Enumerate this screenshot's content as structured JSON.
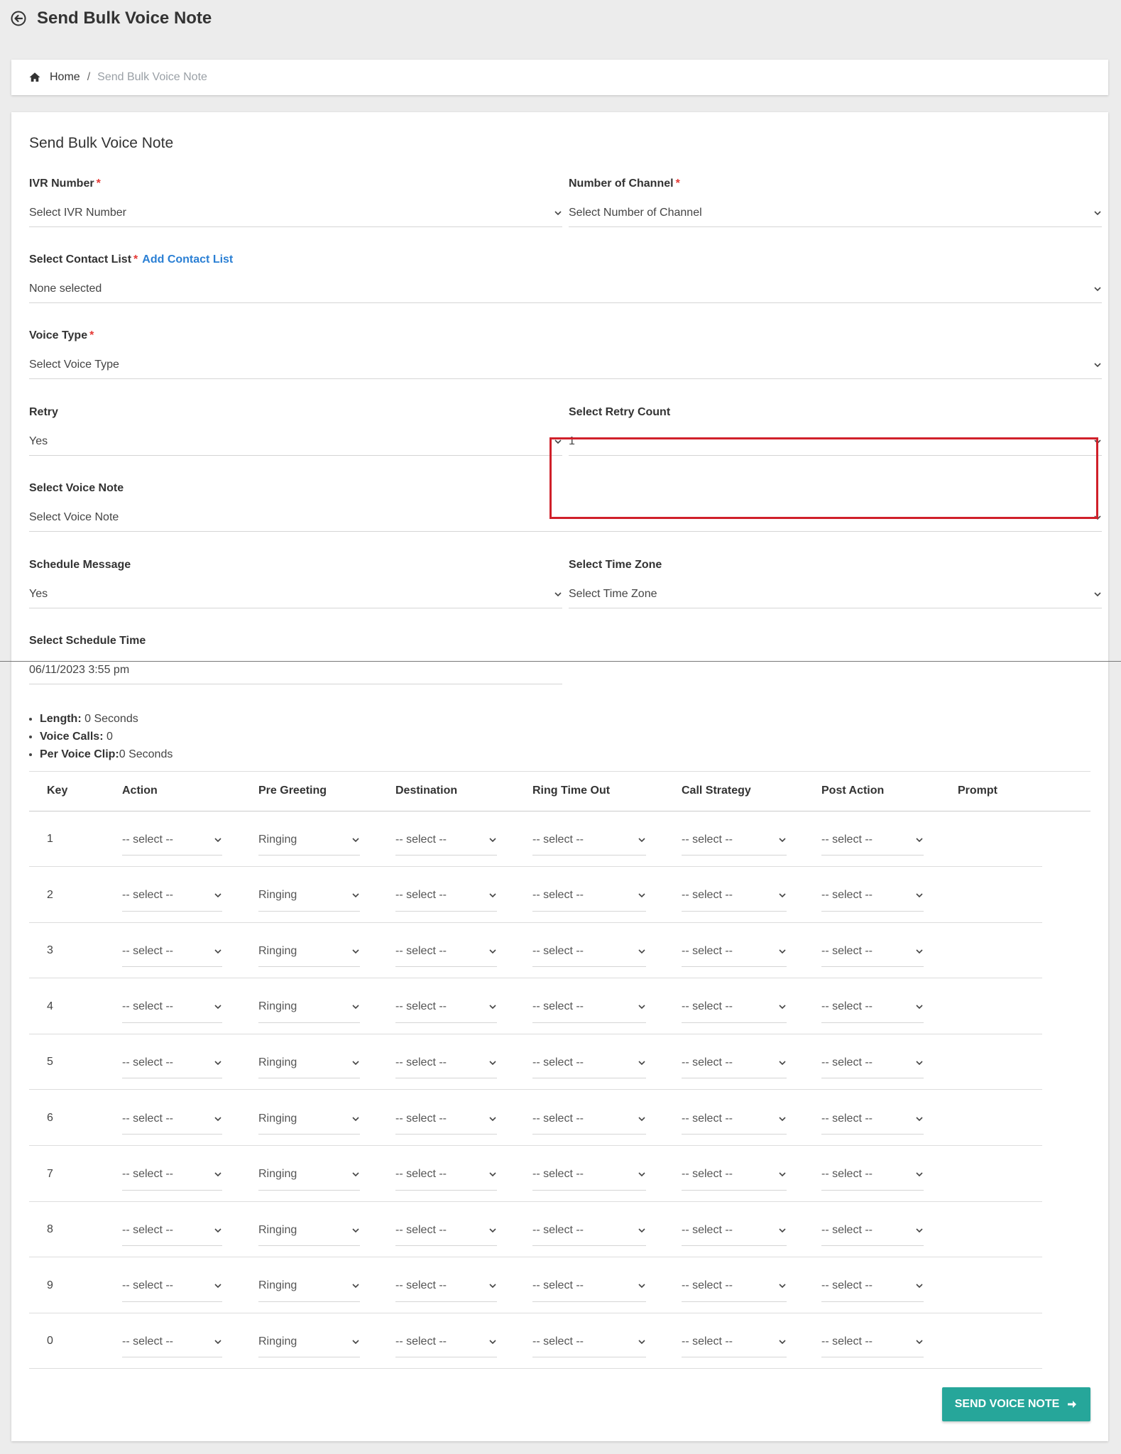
{
  "page": {
    "title": "Send Bulk Voice Note"
  },
  "breadcrumb": {
    "home": "Home",
    "separator": "/",
    "current": "Send Bulk Voice Note"
  },
  "card": {
    "title": "Send Bulk Voice Note"
  },
  "form": {
    "ivr_number": {
      "label": "IVR Number",
      "required": "*",
      "value": "Select IVR Number"
    },
    "channels": {
      "label": "Number of Channel",
      "required": "*",
      "value": "Select Number of Channel"
    },
    "contact_list": {
      "label": "Select Contact List",
      "required": "*",
      "link": "Add Contact List",
      "value": "None selected"
    },
    "voice_type": {
      "label": "Voice Type",
      "required": "*",
      "value": "Select Voice Type"
    },
    "retry": {
      "label": "Retry",
      "value": "Yes"
    },
    "retry_count": {
      "label": "Select Retry Count",
      "value": "1"
    },
    "voice_note": {
      "label": "Select Voice Note",
      "value": "Select Voice Note"
    },
    "schedule": {
      "label": "Schedule Message",
      "value": "Yes"
    },
    "time_zone": {
      "label": "Select Time Zone",
      "value": "Select Time Zone"
    },
    "schedule_time": {
      "label": "Select Schedule Time",
      "value": "06/11/2023 3:55 pm"
    }
  },
  "info": {
    "length_label": "Length:",
    "length_value": " 0 Seconds",
    "calls_label": "Voice Calls:",
    "calls_value": " 0",
    "clip_label": "Per Voice Clip:",
    "clip_value": "0 Seconds"
  },
  "table": {
    "headers": [
      "Key",
      "Action",
      "Pre Greeting",
      "Destination",
      "Ring Time Out",
      "Call Strategy",
      "Post Action",
      "Prompt"
    ],
    "rows": [
      {
        "key": "1",
        "action": "-- select --",
        "pre": "Ringing",
        "dest": "-- select --",
        "ring": "-- select --",
        "strategy": "-- select --",
        "post": "-- select --"
      },
      {
        "key": "2",
        "action": "-- select --",
        "pre": "Ringing",
        "dest": "-- select --",
        "ring": "-- select --",
        "strategy": "-- select --",
        "post": "-- select --"
      },
      {
        "key": "3",
        "action": "-- select --",
        "pre": "Ringing",
        "dest": "-- select --",
        "ring": "-- select --",
        "strategy": "-- select --",
        "post": "-- select --"
      },
      {
        "key": "4",
        "action": "-- select --",
        "pre": "Ringing",
        "dest": "-- select --",
        "ring": "-- select --",
        "strategy": "-- select --",
        "post": "-- select --"
      },
      {
        "key": "5",
        "action": "-- select --",
        "pre": "Ringing",
        "dest": "-- select --",
        "ring": "-- select --",
        "strategy": "-- select --",
        "post": "-- select --"
      },
      {
        "key": "6",
        "action": "-- select --",
        "pre": "Ringing",
        "dest": "-- select --",
        "ring": "-- select --",
        "strategy": "-- select --",
        "post": "-- select --"
      },
      {
        "key": "7",
        "action": "-- select --",
        "pre": "Ringing",
        "dest": "-- select --",
        "ring": "-- select --",
        "strategy": "-- select --",
        "post": "-- select --"
      },
      {
        "key": "8",
        "action": "-- select --",
        "pre": "Ringing",
        "dest": "-- select --",
        "ring": "-- select --",
        "strategy": "-- select --",
        "post": "-- select --"
      },
      {
        "key": "9",
        "action": "-- select --",
        "pre": "Ringing",
        "dest": "-- select --",
        "ring": "-- select --",
        "strategy": "-- select --",
        "post": "-- select --"
      },
      {
        "key": "0",
        "action": "-- select --",
        "pre": "Ringing",
        "dest": "-- select --",
        "ring": "-- select --",
        "strategy": "-- select --",
        "post": "-- select --"
      }
    ]
  },
  "actions": {
    "send_label": "SEND VOICE NOTE"
  },
  "colors": {
    "accent": "#26a69a",
    "required": "#e53935",
    "link": "#2a7fd4",
    "highlight": "#d0202a"
  }
}
